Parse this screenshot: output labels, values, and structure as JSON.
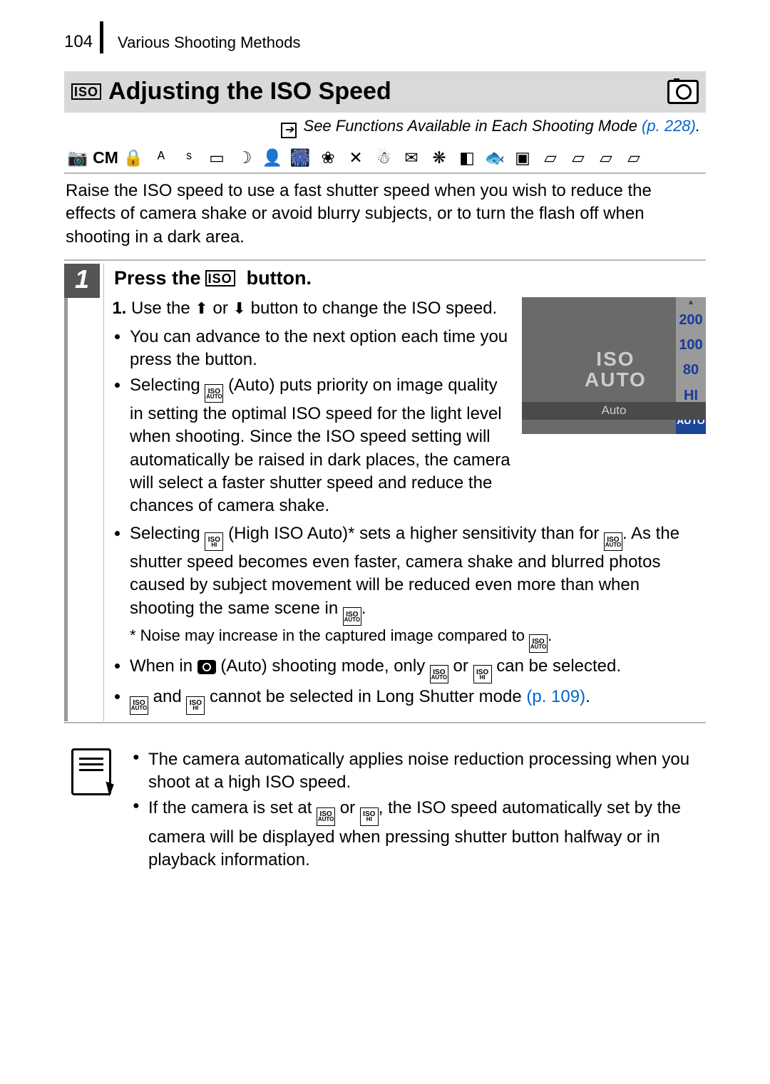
{
  "header": {
    "page_number": "104",
    "chapter_title": "Various Shooting Methods"
  },
  "title": {
    "heading": "Adjusting the ISO Speed",
    "icon_label": "ISO"
  },
  "see_line": {
    "prefix": "See Functions Available in Each Shooting Mode ",
    "link": "(p. 228)",
    "period": "."
  },
  "intro": "Raise the ISO speed to use a fast shutter speed when you wish to reduce the effects of camera shake or avoid blurry subjects, or to turn the flash off when shooting in a dark area.",
  "step": {
    "number": "1",
    "title_pre": "Press the",
    "title_post": "button.",
    "instr1_pre": "Use the ",
    "instr1_mid": " or ",
    "instr1_post": " button to change the ISO speed.",
    "b1": "You can advance to the next option each time you press the button.",
    "b2_pre": "Selecting ",
    "b2_post": " (Auto) puts priority on image quality in setting the optimal ISO speed for the light level when shooting. Since the ISO speed setting will automatically be raised in dark places, the camera will select a faster shutter speed and reduce the chances of camera shake.",
    "b3_pre": "Selecting ",
    "b3_mid1": " (High ISO Auto)* sets a higher sensitivity than for ",
    "b3_mid2": ". As the shutter speed becomes even faster, camera shake and blurred photos caused by subject movement will be reduced even more than when shooting the same scene in ",
    "b3_post": ".",
    "b3_note_pre": "* Noise may increase in the captured image compared to ",
    "b3_note_post": ".",
    "b4_pre": "When in ",
    "b4_mid1": " (Auto) shooting mode, only ",
    "b4_mid2": " or ",
    "b4_post": " can be selected.",
    "b5_mid1": " and ",
    "b5_mid2": " cannot be selected in Long Shutter mode ",
    "b5_link": "(p. 109)",
    "b5_post": "."
  },
  "lcd": {
    "big_line1": "ISO",
    "big_line2": "AUTO",
    "bar_label": "Auto",
    "options": [
      "200",
      "100",
      "80",
      "HI",
      "AUTO"
    ]
  },
  "notes": {
    "n1": "The camera automatically applies noise reduction processing when you shoot at a high ISO speed.",
    "n2_pre": "If the camera is set at ",
    "n2_mid": " or ",
    "n2_post": ", the ISO speed automatically set by the camera will be displayed when pressing shutter button halfway or in playback information."
  },
  "icons": {
    "iso_auto": {
      "t": "ISO",
      "b": "AUTO"
    },
    "iso_hi": {
      "t": "ISO",
      "b": "HI"
    }
  },
  "mode_icons": [
    "📷",
    "CM",
    "☺",
    "ᴬ",
    "ˢ",
    "▭",
    "☾",
    "👤",
    "🎆",
    "※",
    "✕",
    "ॐ",
    "✉",
    "❋",
    "◧",
    "🐟",
    "▣",
    "▱",
    "▱",
    "▱",
    "▱"
  ]
}
